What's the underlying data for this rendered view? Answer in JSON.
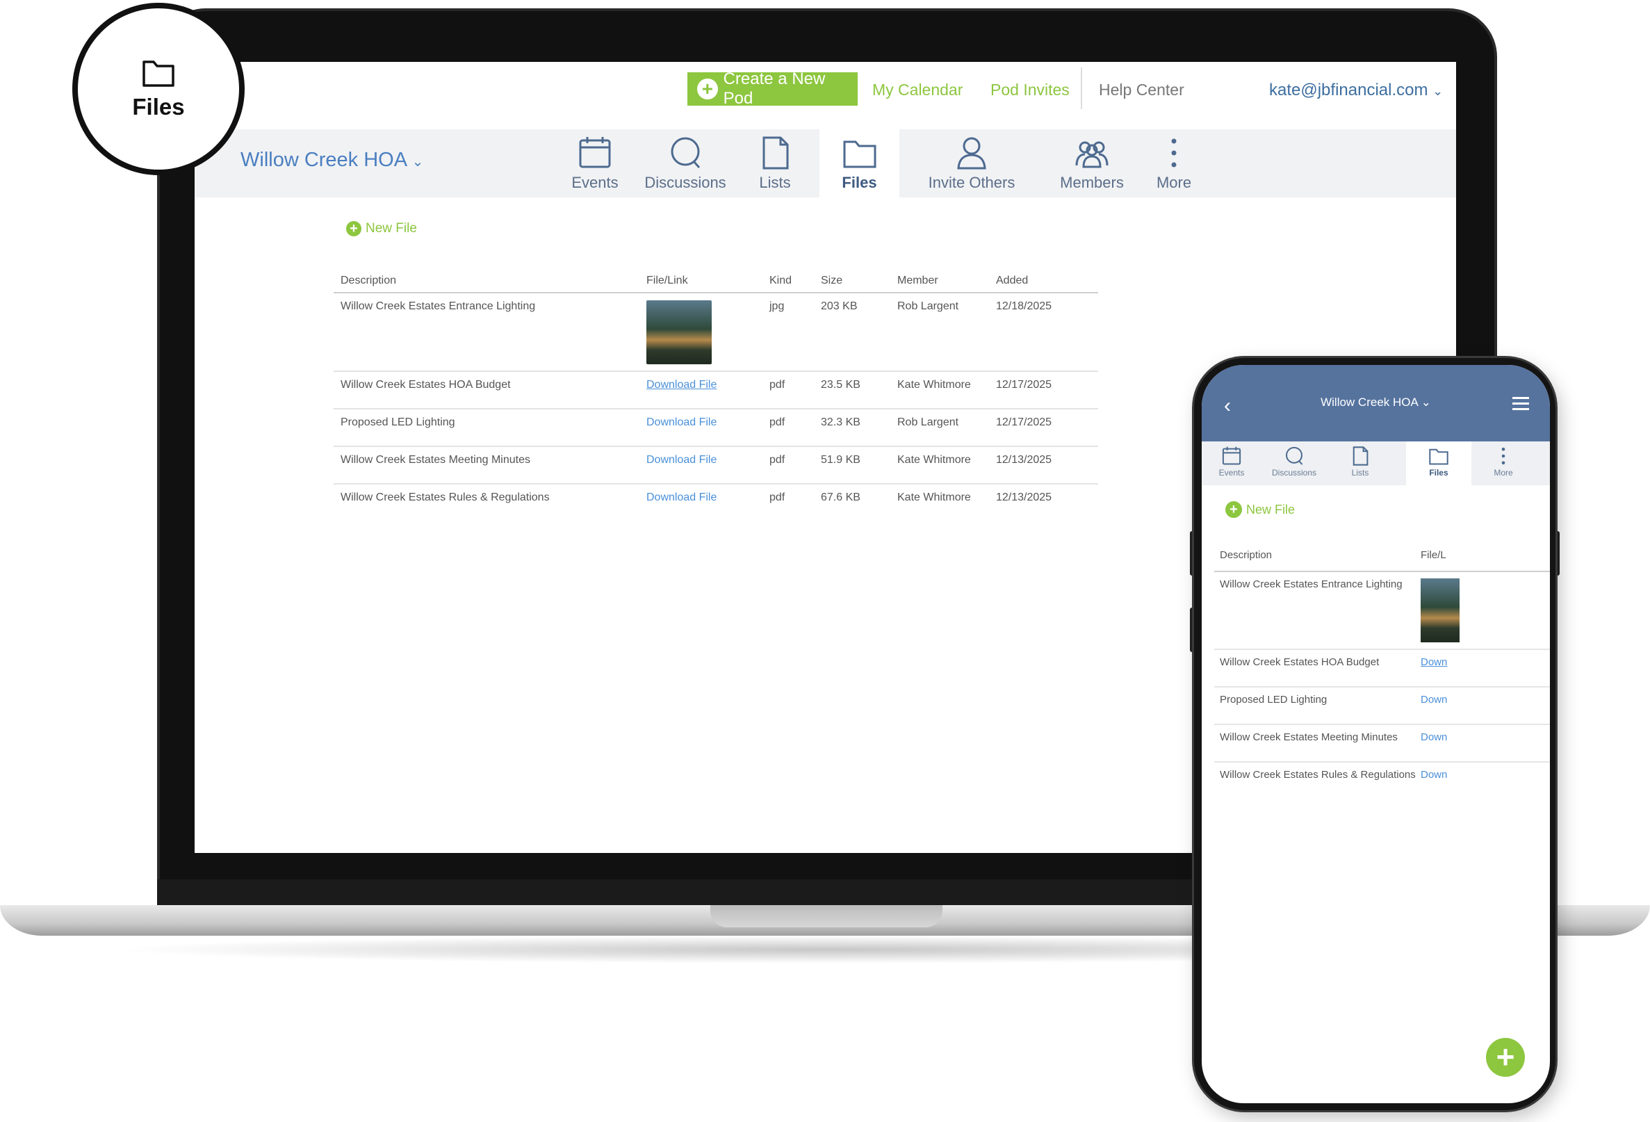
{
  "badge": {
    "label": "Files",
    "icon": "folder-icon"
  },
  "topbar": {
    "create_label": "Create a New Pod",
    "calendar_label": "My Calendar",
    "invites_label": "Pod Invites",
    "help_label": "Help Center",
    "user_email": "kate@jbfinancial.com",
    "accent_color": "#8dc63f"
  },
  "podnav": {
    "title": "Willow Creek HOA",
    "items": [
      {
        "label": "Events",
        "icon": "calendar-icon"
      },
      {
        "label": "Discussions",
        "icon": "chat-bubble-icon"
      },
      {
        "label": "Lists",
        "icon": "document-icon"
      },
      {
        "label": "Files",
        "icon": "folder-icon",
        "active": true
      },
      {
        "label": "Invite Others",
        "icon": "person-icon"
      },
      {
        "label": "Members",
        "icon": "group-icon"
      },
      {
        "label": "More",
        "icon": "more-vertical-icon"
      }
    ]
  },
  "files": {
    "new_file_label": "New File",
    "columns": [
      "Description",
      "File/Link",
      "Kind",
      "Size",
      "Member",
      "Added"
    ],
    "rows": [
      {
        "description": "Willow Creek Estates Entrance Lighting",
        "file": "",
        "kind": "jpg",
        "size": "203 KB",
        "member": "Rob Largent",
        "added": "12/18/2025"
      },
      {
        "description": "Willow Creek Estates HOA Budget",
        "file": "Download File",
        "kind": "pdf",
        "size": "23.5 KB",
        "member": "Kate Whitmore",
        "added": "12/17/2025"
      },
      {
        "description": "Proposed LED Lighting",
        "file": "Download File",
        "kind": "pdf",
        "size": "32.3 KB",
        "member": "Rob Largent",
        "added": "12/17/2025"
      },
      {
        "description": "Willow Creek Estates Meeting Minutes",
        "file": "Download File",
        "kind": "pdf",
        "size": "51.9 KB",
        "member": "Kate Whitmore",
        "added": "12/13/2025"
      },
      {
        "description": "Willow Creek Estates Rules & Regulations",
        "file": "Download File",
        "kind": "pdf",
        "size": "67.6 KB",
        "member": "Kate Whitmore",
        "added": "12/13/2025"
      }
    ]
  },
  "phone": {
    "title": "Willow Creek HOA",
    "nav": [
      {
        "label": "Events",
        "icon": "calendar-icon"
      },
      {
        "label": "Discussions",
        "icon": "chat-bubble-icon"
      },
      {
        "label": "Lists",
        "icon": "document-icon"
      },
      {
        "label": "Files",
        "icon": "folder-icon",
        "active": true
      },
      {
        "label": "More",
        "icon": "more-vertical-icon"
      }
    ],
    "new_file_label": "New File",
    "columns": [
      "Description",
      "File/L"
    ],
    "rows": [
      {
        "description": "Willow Creek Estates Entrance Lighting",
        "file": ""
      },
      {
        "description": "Willow Creek Estates HOA Budget",
        "file": "Down"
      },
      {
        "description": "Proposed LED Lighting",
        "file": "Down"
      },
      {
        "description": "Willow Creek Estates Meeting Minutes",
        "file": "Down"
      },
      {
        "description": "Willow Creek Estates Rules & Regulations",
        "file": "Down"
      }
    ],
    "header_color": "#56739e"
  }
}
